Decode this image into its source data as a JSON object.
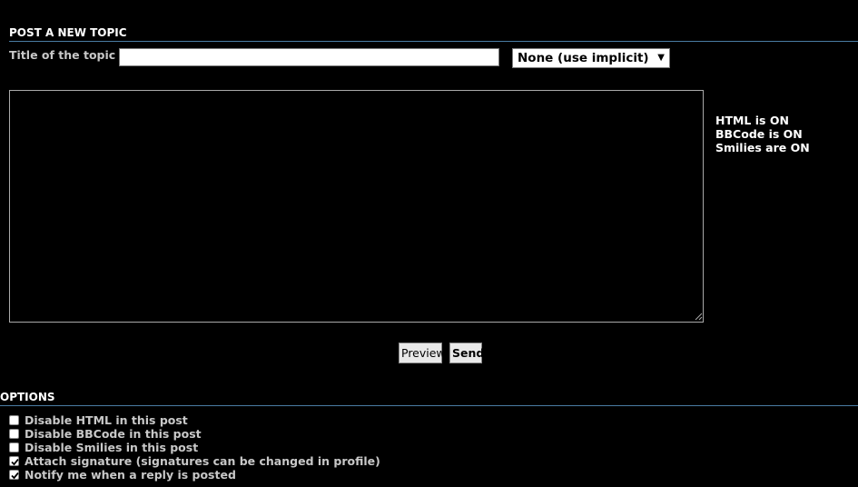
{
  "post_form": {
    "section_title": "POST A NEW TOPIC",
    "topic_label": "Title of the topic",
    "topic_value": "",
    "icon_select_value": "None (use implicit)",
    "message_value": ""
  },
  "status": {
    "html": "HTML is ON",
    "bbcode": "BBCode is ON",
    "smilies": "Smilies are ON"
  },
  "buttons": {
    "preview": "Preview",
    "send": "Send"
  },
  "options": {
    "section_title": "OPTIONS",
    "items": [
      {
        "label": "Disable HTML in this post",
        "checked": false
      },
      {
        "label": "Disable BBCode in this post",
        "checked": false
      },
      {
        "label": "Disable Smilies in this post",
        "checked": false
      },
      {
        "label": "Attach signature (signatures can be changed in profile)",
        "checked": true
      },
      {
        "label": "Notify me when a reply is posted",
        "checked": true
      }
    ]
  },
  "colors": {
    "background": "#000000",
    "rule": "#4a7ca3",
    "label_grey": "#c8c8c8"
  }
}
